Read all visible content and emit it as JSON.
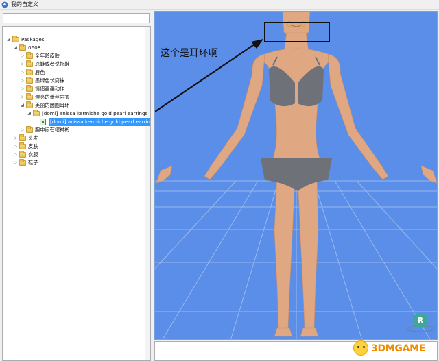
{
  "window": {
    "title": "我的自定义"
  },
  "search": {
    "placeholder": ""
  },
  "tree": {
    "items": [
      {
        "label": "Packages",
        "level": 0,
        "expander": "minus",
        "icon": "folder"
      },
      {
        "label": "0608",
        "level": 1,
        "expander": "minus",
        "icon": "folder"
      },
      {
        "label": "全年龄皮肤",
        "level": 2,
        "expander": "plus",
        "icon": "folder"
      },
      {
        "label": "凉鞋或者说拖鞋",
        "level": 2,
        "expander": "plus",
        "icon": "folder"
      },
      {
        "label": "唇色",
        "level": 2,
        "expander": "plus",
        "icon": "folder"
      },
      {
        "label": "墨绿色长筒袜",
        "level": 2,
        "expander": "plus",
        "icon": "folder"
      },
      {
        "label": "情侣画画动作",
        "level": 2,
        "expander": "plus",
        "icon": "folder"
      },
      {
        "label": "漂亮的蕾丝内衣",
        "level": 2,
        "expander": "plus",
        "icon": "folder"
      },
      {
        "label": "美丽的圆圈耳环",
        "level": 2,
        "expander": "minus",
        "icon": "folder"
      },
      {
        "label": "[domi] anissa kermiche gold pearl earrings",
        "level": 3,
        "expander": "minus",
        "icon": "folder"
      },
      {
        "label": "[domi] anissa kermiche gold pearl earrings",
        "level": 4,
        "expander": "none",
        "icon": "file",
        "selected": true
      },
      {
        "label": "胸中间有褶衬衫",
        "level": 2,
        "expander": "plus",
        "icon": "folder"
      },
      {
        "label": "头发",
        "level": 1,
        "expander": "plus",
        "icon": "folder"
      },
      {
        "label": "皮肤",
        "level": 1,
        "expander": "plus",
        "icon": "folder"
      },
      {
        "label": "衣服",
        "level": 1,
        "expander": "plus",
        "icon": "folder"
      },
      {
        "label": "鞋子",
        "level": 1,
        "expander": "plus",
        "icon": "folder"
      }
    ]
  },
  "preview": {
    "annotation": "这个是耳环啊",
    "badge_letter": "R",
    "background_color": "#5b8ee8"
  },
  "watermark": {
    "text": "3DMGAME"
  }
}
